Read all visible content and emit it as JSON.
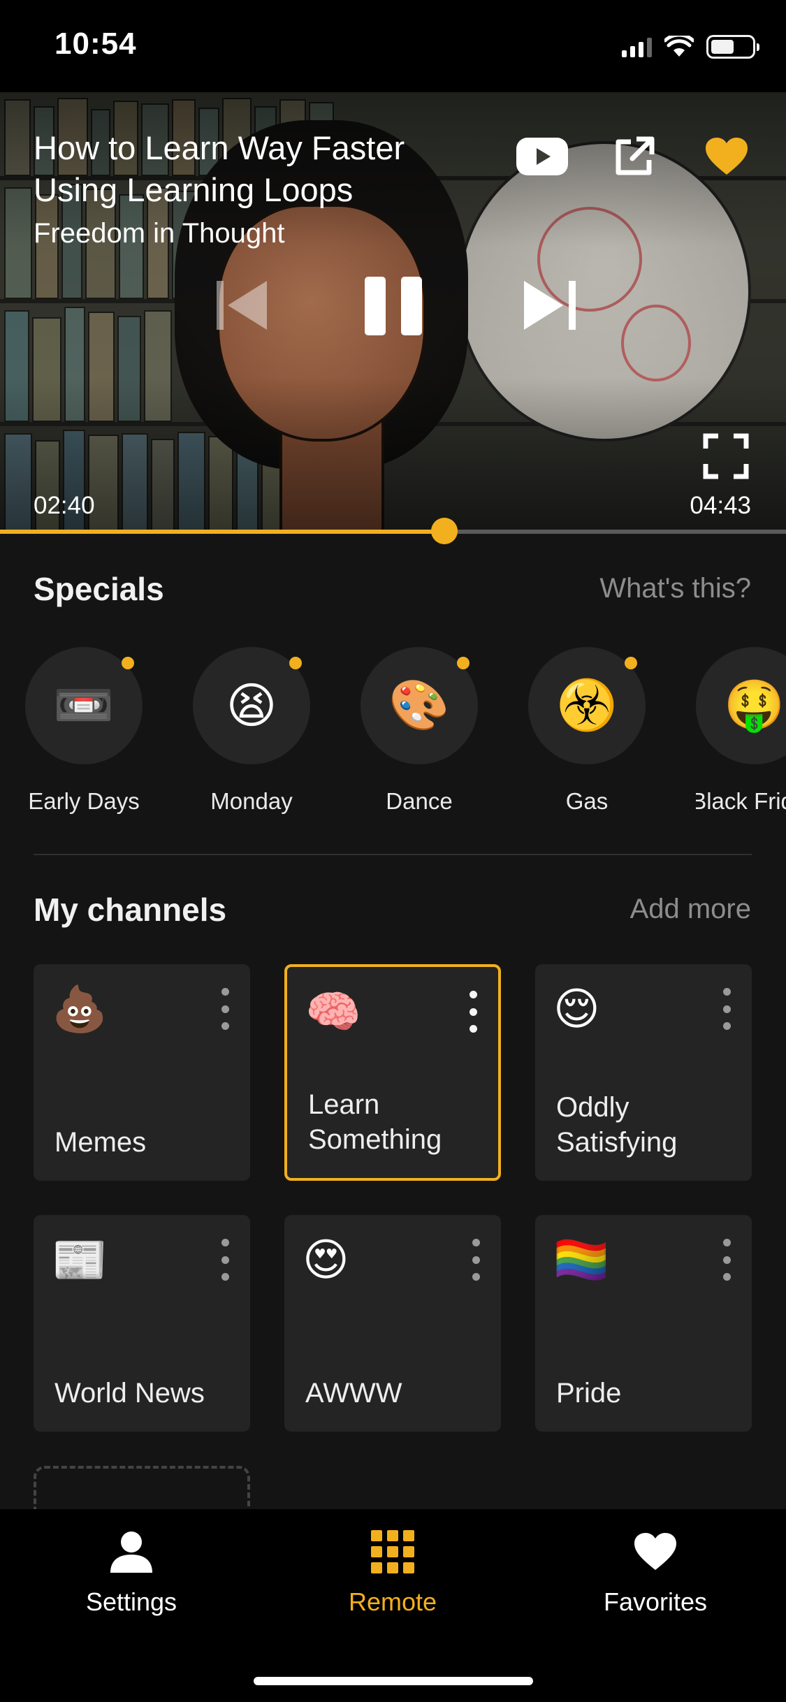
{
  "status_bar": {
    "time": "10:54"
  },
  "player": {
    "title": "How to Learn Way Faster Using Learning Loops",
    "channel": "Freedom in Thought",
    "current_time": "02:40",
    "total_time": "04:43",
    "progress": 0.565,
    "accent": "#f2b01e",
    "icons": [
      "youtube-icon",
      "share-icon",
      "heart-icon",
      "previous-icon",
      "pause-icon",
      "next-icon",
      "fullscreen-icon"
    ]
  },
  "specials": {
    "title": "Specials",
    "link": "What's this?",
    "items": [
      {
        "label": "Early Days",
        "emoji": "📼",
        "new": true
      },
      {
        "label": "Monday",
        "emoji": "😫",
        "new": true
      },
      {
        "label": "Dance",
        "emoji": "🎨",
        "new": true
      },
      {
        "label": "Gas",
        "emoji": "☣️",
        "new": true
      },
      {
        "label": "Black Friday",
        "emoji": "🤑",
        "new": false
      }
    ]
  },
  "channels": {
    "title": "My channels",
    "link": "Add more",
    "items": [
      {
        "label": "Memes",
        "emoji": "💩",
        "active": false
      },
      {
        "label": "Learn Something",
        "emoji": "🧠",
        "active": true
      },
      {
        "label": "Oddly Satisfying",
        "emoji": "😌",
        "active": false
      },
      {
        "label": "World News",
        "emoji": "📰",
        "active": false
      },
      {
        "label": "AWWW",
        "emoji": "😍",
        "active": false
      },
      {
        "label": "Pride",
        "emoji": "🏳️‍🌈",
        "active": false
      }
    ]
  },
  "tab_bar": {
    "tabs": [
      {
        "label": "Settings",
        "icon": "person-icon",
        "active": false
      },
      {
        "label": "Remote",
        "icon": "grid-icon",
        "active": true
      },
      {
        "label": "Favorites",
        "icon": "heart-icon",
        "active": false
      }
    ],
    "active_color": "#f2b01e"
  }
}
